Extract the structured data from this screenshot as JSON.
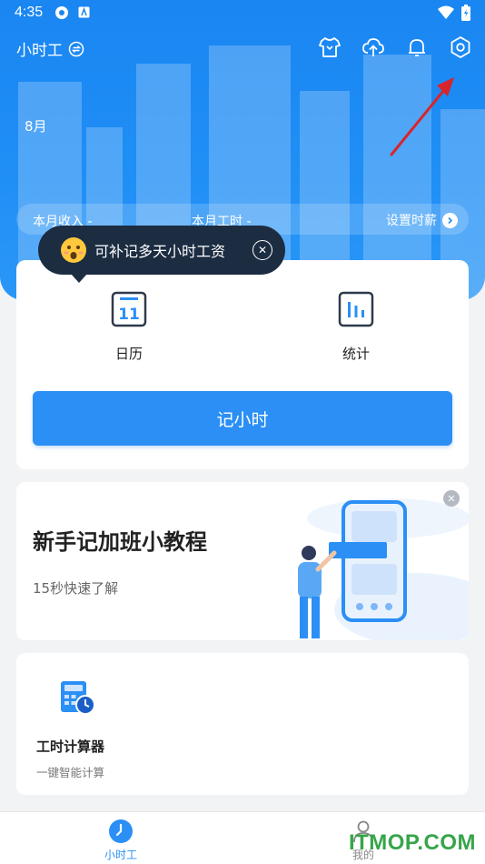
{
  "status_bar": {
    "time": "4:35"
  },
  "app_bar": {
    "title": "小时工"
  },
  "header": {
    "month": "8月"
  },
  "summary": {
    "income_label": "本月收入 -",
    "hours_label": "本月工时 -",
    "setting_label": "设置时薪"
  },
  "tooltip": {
    "text": "可补记多天小时工资"
  },
  "quick_actions": {
    "calendar_label": "日历",
    "calendar_day": "11",
    "stats_label": "统计",
    "record_button": "记小时"
  },
  "tutorial": {
    "title": "新手记加班小教程",
    "subtitle": "15秒快速了解"
  },
  "tools": [
    {
      "name": "工时计算器",
      "desc": "一键智能计算"
    }
  ],
  "bottom_nav": {
    "items": [
      {
        "label": "小时工"
      },
      {
        "label": "我的"
      }
    ]
  },
  "watermark": "ITMOP.COM",
  "colors": {
    "primary": "#2b8ff5",
    "header_gradient_top": "#1a86f2",
    "tooltip_bg": "#1c2d42",
    "annotation_arrow": "#d8252b",
    "watermark": "#36a54a"
  },
  "icons": [
    "shirt-icon",
    "cloud-upload-icon",
    "bell-icon",
    "settings-hexagon-icon",
    "switch-icon",
    "chevron-right-icon",
    "calendar-icon",
    "stats-icon",
    "clock-icon",
    "person-icon",
    "calculator-clock-icon",
    "close-icon"
  ]
}
